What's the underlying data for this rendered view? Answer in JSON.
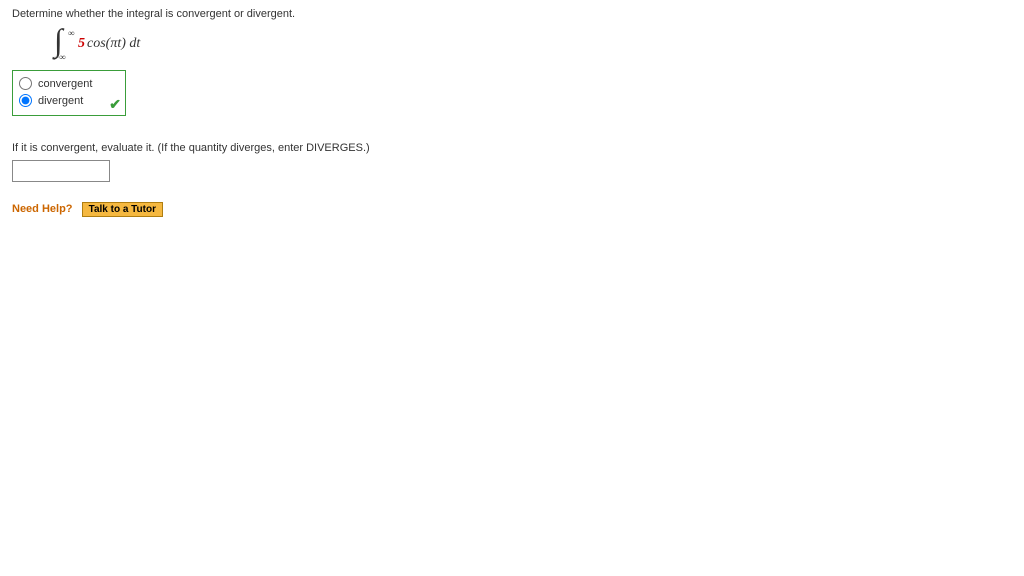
{
  "question": {
    "prompt": "Determine whether the integral is convergent or divergent.",
    "integral": {
      "upper": "∞",
      "lower": "−∞",
      "coef": "5",
      "rest": "cos(πt) dt"
    },
    "options": [
      {
        "label": "convergent",
        "selected": false
      },
      {
        "label": "divergent",
        "selected": true
      }
    ],
    "correct": true
  },
  "followup": {
    "prompt": "If it is convergent, evaluate it. (If the quantity diverges, enter DIVERGES.)",
    "value": ""
  },
  "help": {
    "label": "Need Help?",
    "tutor_btn": "Talk to a Tutor"
  }
}
